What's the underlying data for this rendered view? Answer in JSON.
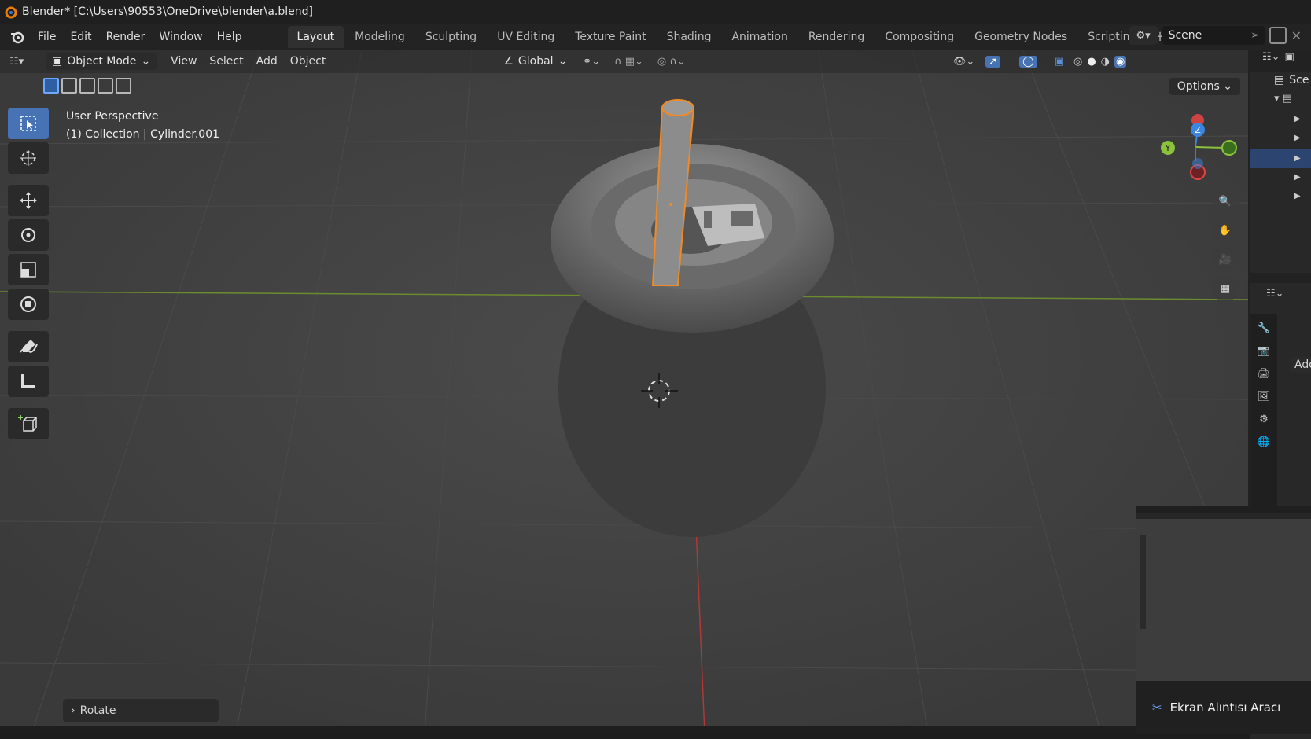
{
  "window": {
    "title": "Blender* [C:\\Users\\90553\\OneDrive\\blender\\a.blend]"
  },
  "menu": {
    "items": [
      "File",
      "Edit",
      "Render",
      "Window",
      "Help"
    ]
  },
  "workspaces": {
    "tabs": [
      "Layout",
      "Modeling",
      "Sculpting",
      "UV Editing",
      "Texture Paint",
      "Shading",
      "Animation",
      "Rendering",
      "Compositing",
      "Geometry Nodes",
      "Scripting"
    ],
    "active": "Layout",
    "add_label": "+"
  },
  "scene": {
    "name": "Scene"
  },
  "viewport_header": {
    "mode": "Object Mode",
    "menus": [
      "View",
      "Select",
      "Add",
      "Object"
    ],
    "transform_orientation": "Global",
    "options_label": "Options"
  },
  "viewport_overlay": {
    "view_name": "User Perspective",
    "collection_info": "(1) Collection | Cylinder.001"
  },
  "gizmo": {
    "x_label": "X",
    "y_label": "Y",
    "z_label": "Z",
    "colors": {
      "x": "#e04444",
      "y": "#8ac23c",
      "z": "#3a86e0"
    }
  },
  "last_operator": {
    "label": "Rotate"
  },
  "right_panel": {
    "outliner_header": "Sce",
    "props_add": "Add"
  },
  "notification": {
    "label": "Ekran Alıntısı Aracı"
  },
  "colors": {
    "accent": "#4772b3",
    "selection_outline": "#f08a24",
    "viewport_bg": "#3f3f3f"
  }
}
